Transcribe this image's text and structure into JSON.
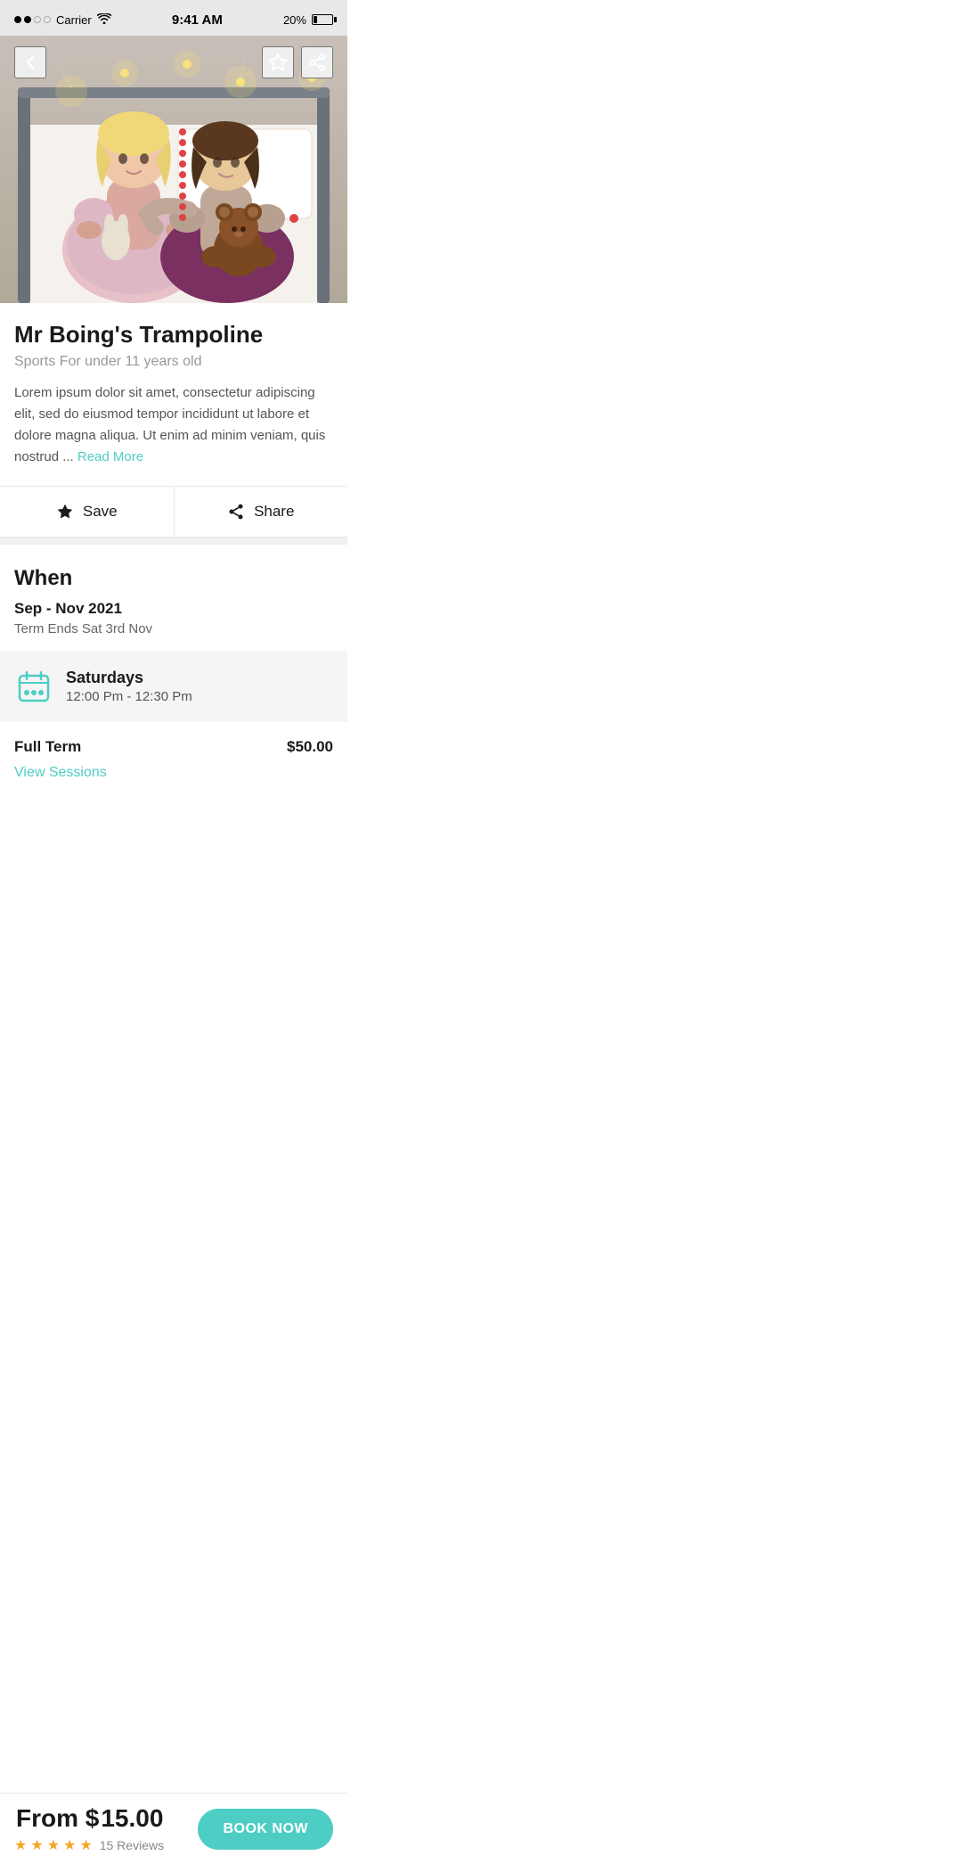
{
  "statusBar": {
    "carrier": "Carrier",
    "time": "9:41 AM",
    "battery": "20%"
  },
  "nav": {
    "backLabel": "‹",
    "saveLabel": "★",
    "shareLabel": "⊕"
  },
  "hero": {
    "altText": "Two children sitting on a bed with toys"
  },
  "listing": {
    "title": "Mr Boing's Trampoline",
    "subtitle": "Sports For under 11 years old",
    "description": "Lorem ipsum dolor sit amet, consectetur adipiscing elit, sed do eiusmod tempor incididunt ut labore et dolore magna aliqua. Ut enim ad minim veniam, quis nostrud ...",
    "readMoreLabel": "Read More"
  },
  "actions": {
    "saveLabel": "Save",
    "shareLabel": "Share"
  },
  "when": {
    "sectionTitle": "When",
    "dateRange": "Sep - Nov 2021",
    "termEnds": "Term Ends Sat 3rd Nov",
    "scheduleDay": "Saturdays",
    "scheduleTime": "12:00 Pm - 12:30 Pm"
  },
  "pricing": {
    "fullTermLabel": "Full Term",
    "fullTermPrice": "$50.00",
    "viewSessionsLabel": "View Sessions",
    "fromLabel": "From $",
    "fromPrice": "15.00",
    "reviewsCount": "15 Reviews",
    "bookNowLabel": "BOOK NOW",
    "starsCount": 5
  }
}
